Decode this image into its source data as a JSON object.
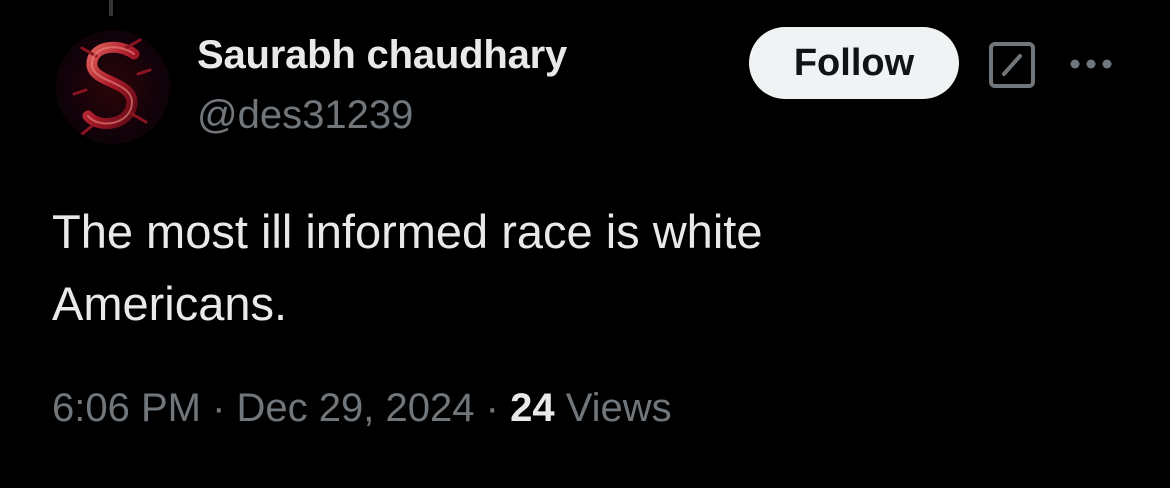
{
  "user": {
    "display_name": "Saurabh chaudhary",
    "handle": "@des31239"
  },
  "actions": {
    "follow_label": "Follow",
    "grok_icon": "grok-icon",
    "more_icon": "more-icon"
  },
  "tweet": {
    "text": "The most ill informed race is white\nAmericans.",
    "time": "6:06 PM",
    "separator": "·",
    "date": "Dec 29, 2024",
    "views_count": "24",
    "views_label": "Views"
  },
  "colors": {
    "background": "#000000",
    "primary_text": "#e7e9ea",
    "secondary_text": "#71767b",
    "follow_bg": "#eff3f4",
    "avatar_accent": "#c0392b"
  }
}
